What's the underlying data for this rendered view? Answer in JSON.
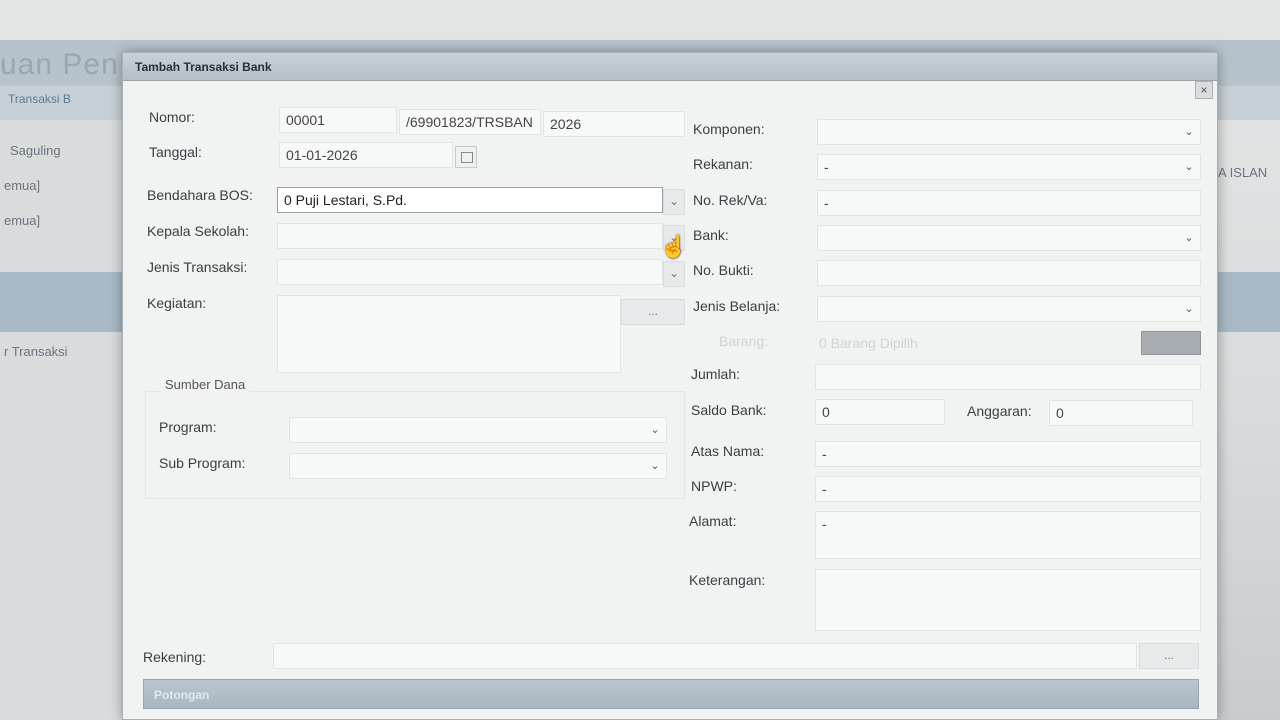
{
  "background": {
    "title": "uan Pen",
    "tab": "Transaksi B",
    "items": [
      "Saguling",
      "emua]",
      "emua]"
    ],
    "row_label": "r Transaksi",
    "right_label": "A ISLAN"
  },
  "modal": {
    "title": "Tambah Transaksi Bank",
    "close_icon": "×"
  },
  "left": {
    "nomor": {
      "label": "Nomor:",
      "part1": "00001",
      "part2": "/69901823/TRSBAN",
      "part3": "2026"
    },
    "tanggal": {
      "label": "Tanggal:",
      "value": "01-01-2026"
    },
    "bendahara": {
      "label": "Bendahara BOS:",
      "value": "0 Puji Lestari, S.Pd."
    },
    "kepala": {
      "label": "Kepala Sekolah:",
      "value": ""
    },
    "jenis_transaksi": {
      "label": "Jenis Transaksi:",
      "value": ""
    },
    "kegiatan": {
      "label": "Kegiatan:",
      "value": "",
      "button": "..."
    },
    "sumber_dana": {
      "title": "Sumber Dana",
      "program_label": "Program:",
      "sub_program_label": "Sub Program:"
    }
  },
  "right": {
    "komponen": {
      "label": "Komponen:",
      "value": ""
    },
    "rekanan": {
      "label": "Rekanan:",
      "value": "-"
    },
    "no_rek": {
      "label": "No. Rek/Va:",
      "value": "-"
    },
    "bank": {
      "label": "Bank:",
      "value": ""
    },
    "no_bukti": {
      "label": "No. Bukti:",
      "value": ""
    },
    "jenis_belanja": {
      "label": "Jenis Belanja:",
      "value": ""
    },
    "barang": {
      "label": "Barang:",
      "value": "0 Barang Dipilih"
    },
    "jumlah": {
      "label": "Jumlah:",
      "value": ""
    },
    "saldo_bank": {
      "label": "Saldo Bank:",
      "value": "0"
    },
    "anggaran": {
      "label": "Anggaran:",
      "value": "0"
    },
    "atas_nama": {
      "label": "Atas Nama:",
      "value": "-"
    },
    "npwp": {
      "label": "NPWP:",
      "value": "-"
    },
    "alamat": {
      "label": "Alamat:",
      "value": "-"
    },
    "keterangan": {
      "label": "Keterangan:",
      "value": ""
    }
  },
  "rekening": {
    "label": "Rekening:",
    "value": "",
    "button": "..."
  },
  "potongan": {
    "title": "Potongan"
  },
  "icons": {
    "dropdown": "chevron-down-icon",
    "calendar": "calendar-icon",
    "cursor": "hand-cursor-icon"
  },
  "colors": {
    "titlebar": "#b4bec5",
    "section_bar": "#a8b6c0",
    "modal_bg": "#f1f2f2"
  }
}
